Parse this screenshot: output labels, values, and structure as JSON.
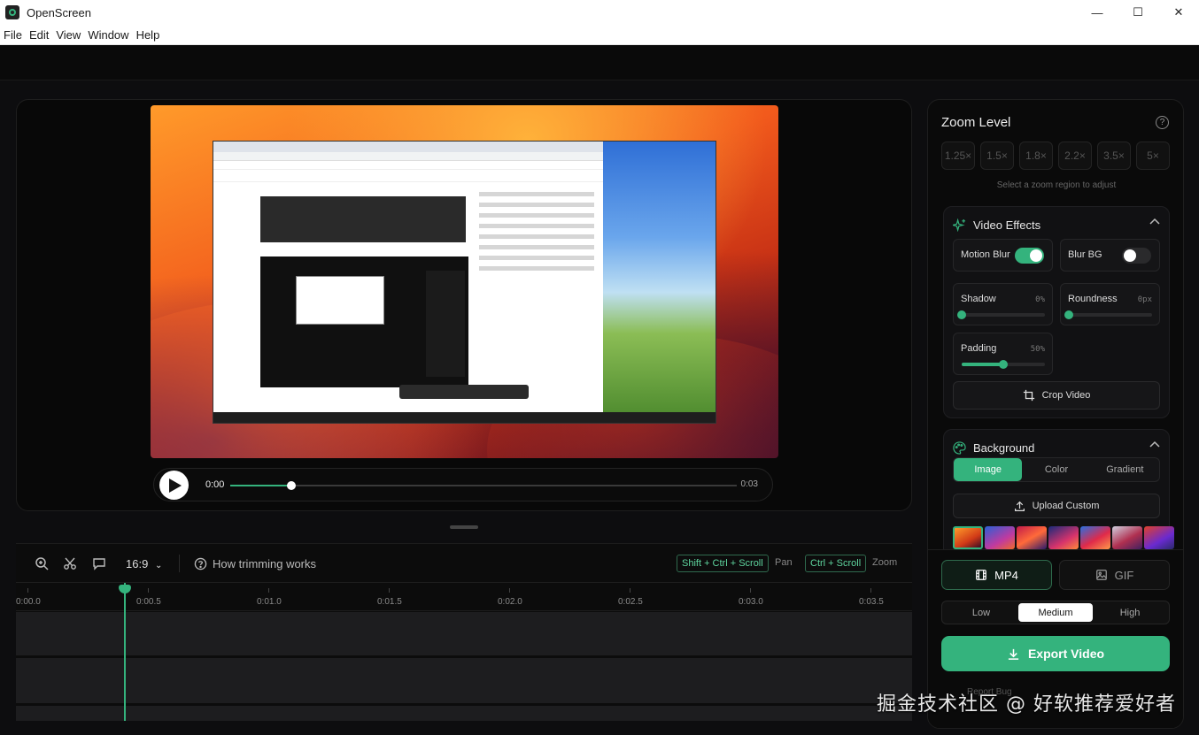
{
  "window": {
    "title": "OpenScreen",
    "minimize": "—",
    "maximize": "☐",
    "close": "✕"
  },
  "menu": [
    "File",
    "Edit",
    "View",
    "Window",
    "Help"
  ],
  "player": {
    "current_time": "0:00",
    "duration": "0:03",
    "progress": 0.12
  },
  "timeline": {
    "aspect": "16:9",
    "how_trimming": "How trimming works",
    "pan_shortcut": "Shift + Ctrl + Scroll",
    "pan_label": "Pan",
    "zoom_shortcut": "Ctrl + Scroll",
    "zoom_label": "Zoom",
    "ticks": [
      "0:00.0",
      "0:00.5",
      "0:01.0",
      "0:01.5",
      "0:02.0",
      "0:02.5",
      "0:03.0",
      "0:03.5"
    ],
    "playhead_time": 0.4
  },
  "side": {
    "zoom_title": "Zoom Level",
    "zoom_levels": [
      "1.25×",
      "1.5×",
      "1.8×",
      "2.2×",
      "3.5×",
      "5×"
    ],
    "zoom_hint": "Select a zoom region to adjust",
    "effects_title": "Video Effects",
    "motion_blur": {
      "label": "Motion Blur",
      "on": true
    },
    "blur_bg": {
      "label": "Blur BG",
      "on": false
    },
    "shadow": {
      "label": "Shadow",
      "value_text": "0%",
      "value": 0
    },
    "roundness": {
      "label": "Roundness",
      "value_text": "0px",
      "value": 0
    },
    "padding": {
      "label": "Padding",
      "value_text": "50%",
      "value": 0.5
    },
    "crop_label": "Crop Video",
    "background_title": "Background",
    "bg_tabs": [
      "Image",
      "Color",
      "Gradient"
    ],
    "bg_active": 0,
    "upload_label": "Upload Custom"
  },
  "export": {
    "mp4": "MP4",
    "gif": "GIF",
    "qualities": [
      "Low",
      "Medium",
      "High"
    ],
    "quality_active": 1,
    "export_label": "Export Video",
    "report": "Report Bug"
  },
  "colors": {
    "accent": "#34b37d",
    "panel": "#111113",
    "bg": "#0d0d0f"
  },
  "watermark": "掘金技术社区 @ 好软推荐爱好者"
}
